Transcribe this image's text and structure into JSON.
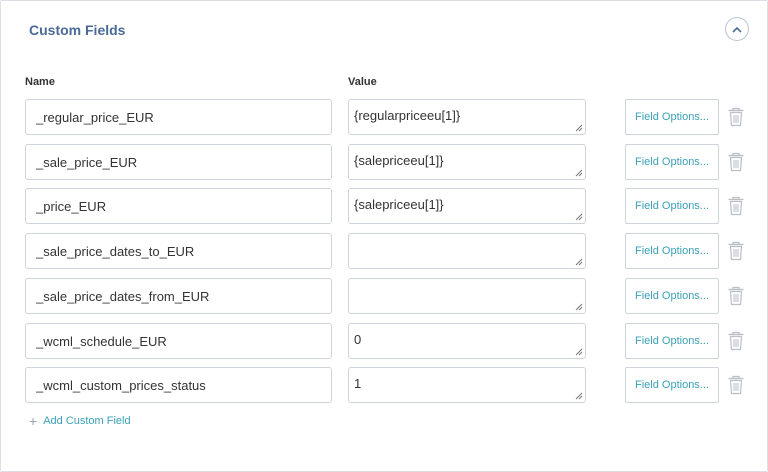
{
  "section": {
    "title": "Custom Fields",
    "collapse_icon": "chevron-up-icon"
  },
  "columns": {
    "name": "Name",
    "value": "Value"
  },
  "fields": [
    {
      "name": "_regular_price_EUR",
      "value": "{regularpriceeu[1]}",
      "options_label": "Field Options..."
    },
    {
      "name": "_sale_price_EUR",
      "value": "{salepriceeu[1]}",
      "options_label": "Field Options..."
    },
    {
      "name": "_price_EUR",
      "value": "{salepriceeu[1]}",
      "options_label": "Field Options..."
    },
    {
      "name": "_sale_price_dates_to_EUR",
      "value": "",
      "options_label": "Field Options..."
    },
    {
      "name": "_sale_price_dates_from_EUR",
      "value": "",
      "options_label": "Field Options..."
    },
    {
      "name": "_wcml_schedule_EUR",
      "value": "0",
      "options_label": "Field Options..."
    },
    {
      "name": "_wcml_custom_prices_status",
      "value": "1",
      "options_label": "Field Options..."
    }
  ],
  "add_button": {
    "icon": "plus-icon",
    "label": "Add Custom Field"
  },
  "colors": {
    "title": "#4a6b98",
    "link": "#3ba0b8",
    "border": "#cfd4da",
    "icon": "#b8bfc6"
  }
}
